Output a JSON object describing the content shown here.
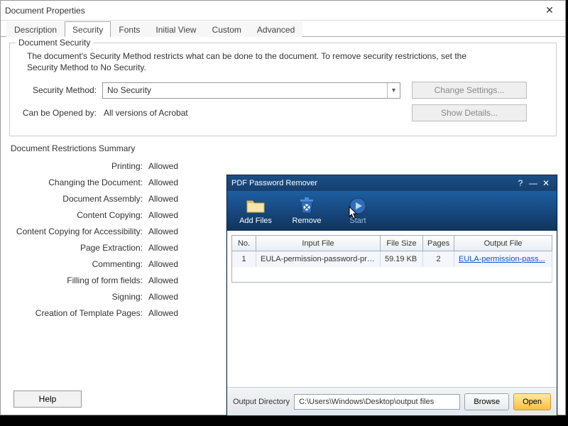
{
  "dp": {
    "title": "Document Properties",
    "tabs": [
      "Description",
      "Security",
      "Fonts",
      "Initial View",
      "Custom",
      "Advanced"
    ],
    "active_tab": 1,
    "group_title": "Document Security",
    "desc": "The document's Security Method restricts what can be done to the document. To remove security restrictions, set the Security Method to No Security.",
    "method_label": "Security Method:",
    "method_value": "No Security",
    "change_btn": "Change Settings...",
    "opened_label": "Can be Opened by:",
    "opened_value": "All versions of Acrobat",
    "details_btn": "Show Details...",
    "restrict_title": "Document Restrictions Summary",
    "restrictions": [
      {
        "label": "Printing:",
        "value": "Allowed"
      },
      {
        "label": "Changing the Document:",
        "value": "Allowed"
      },
      {
        "label": "Document Assembly:",
        "value": "Allowed"
      },
      {
        "label": "Content Copying:",
        "value": "Allowed"
      },
      {
        "label": "Content Copying for Accessibility:",
        "value": "Allowed"
      },
      {
        "label": "Page Extraction:",
        "value": "Allowed"
      },
      {
        "label": "Commenting:",
        "value": "Allowed"
      },
      {
        "label": "Filling of form fields:",
        "value": "Allowed"
      },
      {
        "label": "Signing:",
        "value": "Allowed"
      },
      {
        "label": "Creation of Template Pages:",
        "value": "Allowed"
      }
    ],
    "help": "Help"
  },
  "pr": {
    "title": "PDF Password Remover",
    "toolbar": {
      "add": "Add Files",
      "remove": "Remove",
      "start": "Start"
    },
    "columns": {
      "no": "No.",
      "input": "Input File",
      "size": "File Size",
      "pages": "Pages",
      "output": "Output File"
    },
    "row": {
      "no": "1",
      "input": "EULA-permission-password-prot...",
      "size": "59.19 KB",
      "pages": "2",
      "output": "EULA-permission-pass..."
    },
    "out_label": "Output Directory",
    "out_value": "C:\\Users\\Windows\\Desktop\\output files",
    "browse": "Browse",
    "open": "Open"
  }
}
